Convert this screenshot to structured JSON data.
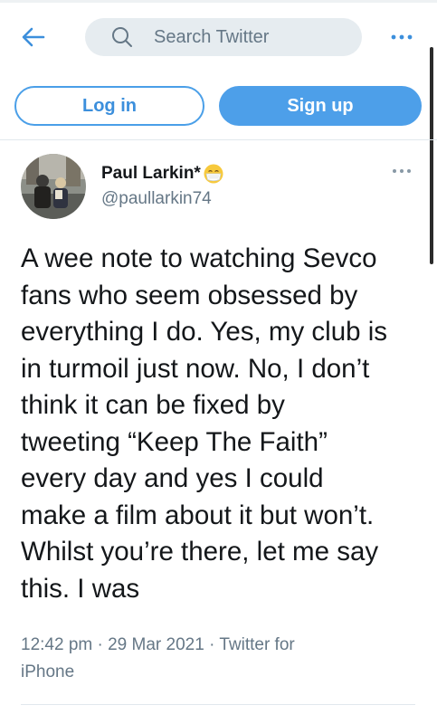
{
  "header": {
    "back_icon": "arrow-left-icon",
    "search_placeholder": "Search Twitter",
    "more_icon": "more-horizontal-icon"
  },
  "auth": {
    "login_label": "Log in",
    "signup_label": "Sign up"
  },
  "tweet": {
    "author_name": "Paul Larkin*",
    "author_emoji": "face-with-medical-mask",
    "author_handle": "@paullarkin74",
    "text_lines": [
      "A wee note to watching Sevco",
      "fans who seem obsessed by",
      "everything I do. Yes, my club is",
      "in turmoil just now. No, I don’t",
      "think it can be fixed by",
      "tweeting “Keep The Faith”",
      "every day and yes I could",
      "make a film about it but won’t.",
      "Whilst you’re there, let me say",
      "this. I was"
    ],
    "meta_lines": [
      "12:42 pm · 29 Mar 2021 · Twitter for",
      "iPhone"
    ]
  },
  "colors": {
    "accent": "#4d9fe9",
    "text": "#14171a",
    "muted": "#657786",
    "search_bg": "#e6ecf0"
  }
}
